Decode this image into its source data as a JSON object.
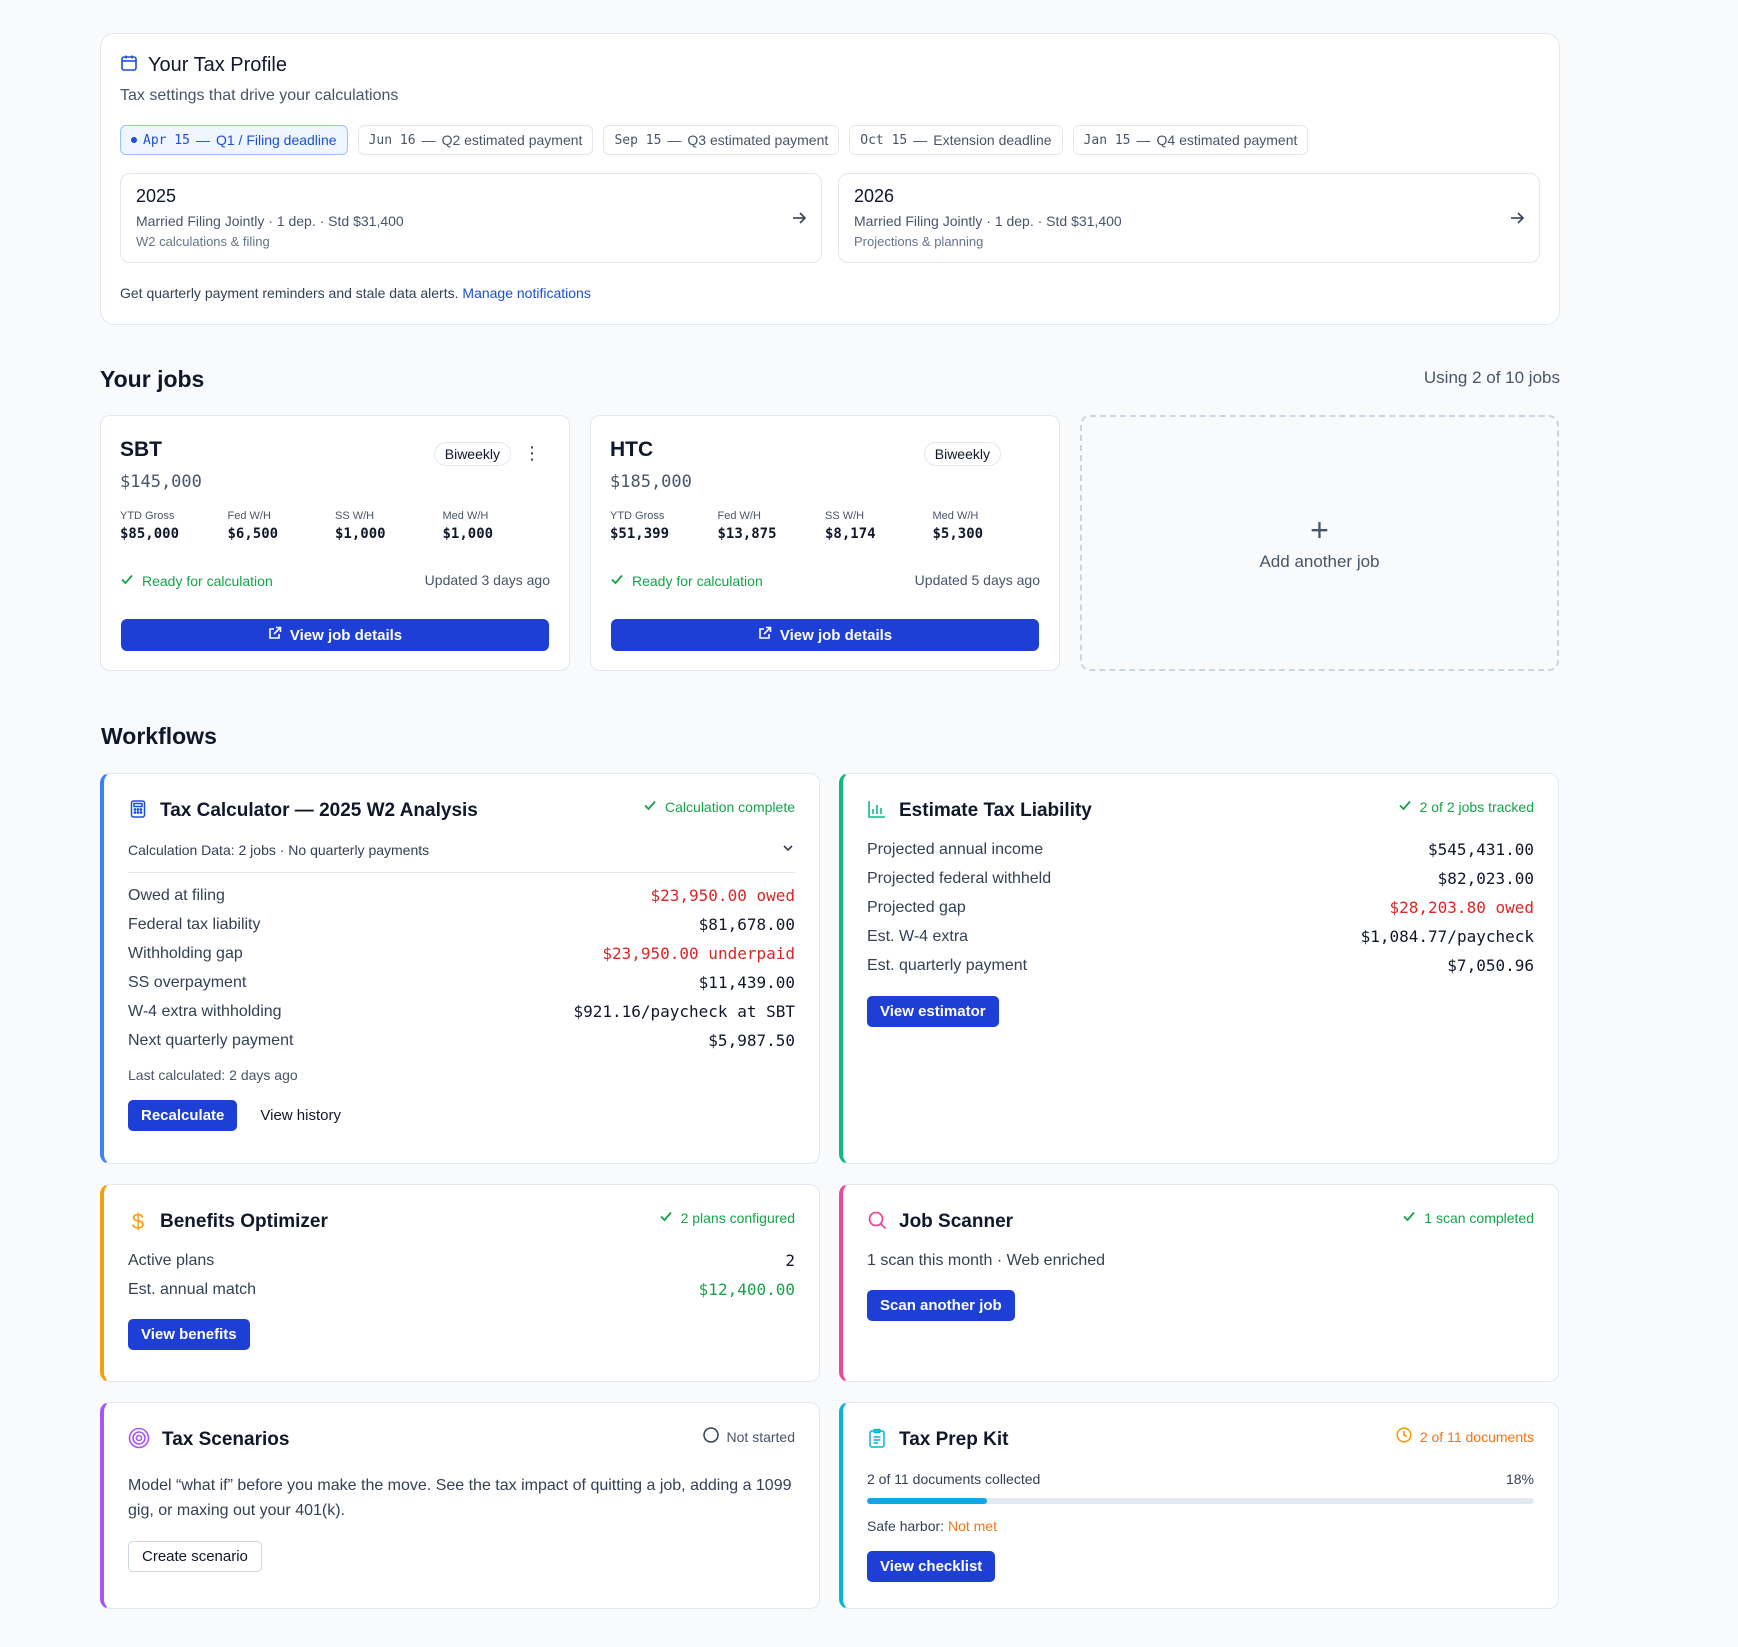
{
  "profile": {
    "title": "Your Tax Profile",
    "subtitle": "Tax settings that drive your calculations",
    "deadlines": [
      {
        "date": "Apr 15",
        "label": "Q1 / Filing deadline",
        "active": true
      },
      {
        "date": "Jun 16",
        "label": "Q2 estimated payment",
        "active": false
      },
      {
        "date": "Sep 15",
        "label": "Q3 estimated payment",
        "active": false
      },
      {
        "date": "Oct 15",
        "label": "Extension deadline",
        "active": false
      },
      {
        "date": "Jan 15",
        "label": "Q4 estimated payment",
        "active": false
      }
    ],
    "dash": "—",
    "years": [
      {
        "year": "2025",
        "details": "Married Filing Jointly · 1 dep. · Std $31,400",
        "note": "W2 calculations & filing"
      },
      {
        "year": "2026",
        "details": "Married Filing Jointly · 1 dep. · Std $31,400",
        "note": "Projections & planning"
      }
    ],
    "notify_text": "Get quarterly payment reminders and stale data alerts.",
    "notify_link": "Manage notifications"
  },
  "jobs": {
    "title": "Your jobs",
    "usage": "Using 2 of 10 jobs",
    "stat_labels": [
      "YTD Gross",
      "Fed W/H",
      "SS W/H",
      "Med W/H"
    ],
    "items": [
      {
        "name": "SBT",
        "salary": "$145,000",
        "frequency": "Biweekly",
        "stats": [
          "$85,000",
          "$6,500",
          "$1,000",
          "$1,000"
        ],
        "status": "Ready for calculation",
        "updated": "Updated 3 days ago",
        "button": "View job details"
      },
      {
        "name": "HTC",
        "salary": "$185,000",
        "frequency": "Biweekly",
        "stats": [
          "$51,399",
          "$13,875",
          "$8,174",
          "$5,300"
        ],
        "status": "Ready for calculation",
        "updated": "Updated 5 days ago",
        "button": "View job details"
      }
    ],
    "add_label": "Add another job"
  },
  "workflows": {
    "title": "Workflows",
    "calculator": {
      "title": "Tax Calculator — 2025 W2 Analysis",
      "status": "Calculation complete",
      "data_summary": "Calculation Data: 2 jobs · No quarterly payments",
      "rows": [
        {
          "label": "Owed at filing",
          "value": "$23,950.00 owed",
          "tone": "red"
        },
        {
          "label": "Federal tax liability",
          "value": "$81,678.00",
          "tone": ""
        },
        {
          "label": "Withholding gap",
          "value": "$23,950.00 underpaid",
          "tone": "red"
        },
        {
          "label": "SS overpayment",
          "value": "$11,439.00",
          "tone": ""
        },
        {
          "label": "W-4 extra withholding",
          "value": "$921.16/paycheck at SBT",
          "tone": ""
        },
        {
          "label": "Next quarterly payment",
          "value": "$5,987.50",
          "tone": ""
        }
      ],
      "last_calculated": "Last calculated: 2 days ago",
      "primary_button": "Recalculate",
      "secondary_button": "View history",
      "accent": "#3b82f6"
    },
    "liability": {
      "title": "Estimate Tax Liability",
      "status": "2 of 2 jobs tracked",
      "rows": [
        {
          "label": "Projected annual income",
          "value": "$545,431.00",
          "tone": ""
        },
        {
          "label": "Projected federal withheld",
          "value": "$82,023.00",
          "tone": ""
        },
        {
          "label": "Projected gap",
          "value": "$28,203.80 owed",
          "tone": "red"
        },
        {
          "label": "Est. W-4 extra",
          "value": "$1,084.77/paycheck",
          "tone": ""
        },
        {
          "label": "Est. quarterly payment",
          "value": "$7,050.96",
          "tone": ""
        }
      ],
      "button": "View estimator",
      "accent": "#10b981"
    },
    "benefits": {
      "title": "Benefits Optimizer",
      "status": "2 plans configured",
      "rows": [
        {
          "label": "Active plans",
          "value": "2",
          "tone": ""
        },
        {
          "label": "Est. annual match",
          "value": "$12,400.00",
          "tone": "green"
        }
      ],
      "button": "View benefits",
      "accent": "#f59e0b"
    },
    "scanner": {
      "title": "Job Scanner",
      "status": "1 scan completed",
      "summary": "1 scan this month · Web enriched",
      "button": "Scan another job",
      "accent": "#ec4899"
    },
    "scenarios": {
      "title": "Tax Scenarios",
      "status": "Not started",
      "description": "Model “what if” before you make the move. See the tax impact of quitting a job, adding a 1099 gig, or maxing out your 401(k).",
      "button": "Create scenario",
      "accent": "#a855f7"
    },
    "prepkit": {
      "title": "Tax Prep Kit",
      "status": "2 of 11 documents",
      "progress_text": "2 of 11 documents collected",
      "progress_percent_label": "18%",
      "progress": 0.18,
      "safe_harbor_label": "Safe harbor:",
      "safe_harbor_value": "Not met",
      "button": "View checklist",
      "accent": "#06b6d4"
    }
  }
}
